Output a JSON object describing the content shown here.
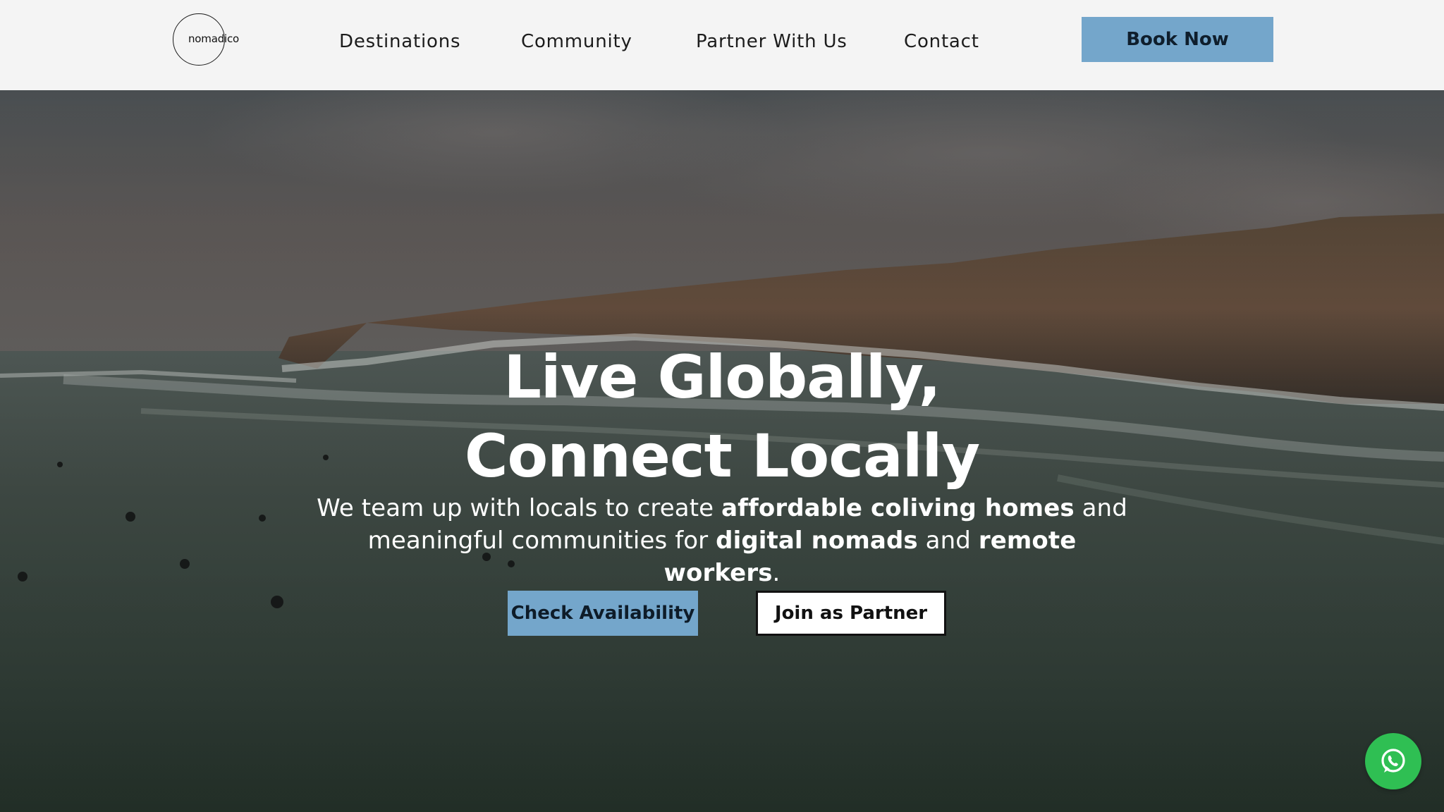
{
  "header": {
    "logo_text": "nomadico",
    "nav": [
      "Destinations",
      "Community",
      "Partner With Us",
      "Contact"
    ],
    "book_label": "Book Now"
  },
  "hero": {
    "title_line1": "Live Globally,",
    "title_line2": "Connect Locally",
    "subtitle": {
      "p1": "We team up with locals to create ",
      "b1": "affordable coliving homes",
      "p2": " and meaningful communities for ",
      "b2": "digital nomads",
      "p3": " and ",
      "b3": "remote workers",
      "p4": "."
    },
    "primary_button": "Check Availability",
    "secondary_button": "Join as Partner"
  },
  "floating": {
    "chat_icon": "whatsapp-icon"
  },
  "colors": {
    "accent": "#74a6cb",
    "header_bg": "#f4f4f4",
    "whatsapp": "#2fbf53"
  }
}
